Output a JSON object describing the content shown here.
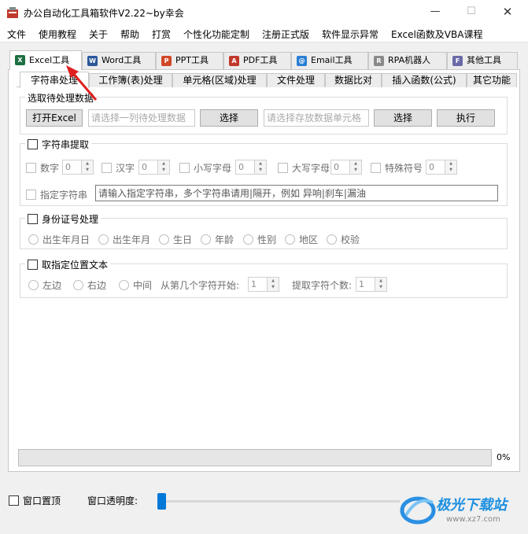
{
  "window": {
    "title": "办公自动化工具箱软件V2.22~by幸会",
    "minimize": "—",
    "maximize": "☐",
    "close": "✕"
  },
  "menu": [
    "文件",
    "使用教程",
    "关于",
    "帮助",
    "打赏",
    "个性化功能定制",
    "注册正式版",
    "软件显示异常",
    "Excel函数及VBA课程"
  ],
  "top_tabs": [
    {
      "label": "Excel工具",
      "icon": "excel-icon",
      "icon_text": "X",
      "color": "#1d6f42"
    },
    {
      "label": "Word工具",
      "icon": "word-icon",
      "icon_text": "W",
      "color": "#2b579a"
    },
    {
      "label": "PPT工具",
      "icon": "ppt-icon",
      "icon_text": "P",
      "color": "#d24726"
    },
    {
      "label": "PDF工具",
      "icon": "pdf-icon",
      "icon_text": "A",
      "color": "#c0392b"
    },
    {
      "label": "Email工具",
      "icon": "email-icon",
      "icon_text": "@",
      "color": "#2a7fd4"
    },
    {
      "label": "RPA机器人",
      "icon": "robot-icon",
      "icon_text": "R",
      "color": "#8a8a8a"
    },
    {
      "label": "其他工具",
      "icon": "folder-icon",
      "icon_text": "F",
      "color": "#6a6aa8"
    }
  ],
  "sub_tabs": [
    "字符串处理",
    "工作簿(表)处理",
    "单元格(区域)处理",
    "文件处理",
    "数据比对",
    "插入函数(公式)",
    "其它功能"
  ],
  "select_group": {
    "title": "选取待处理数据",
    "open_button": "打开Excel",
    "range_placeholder": "请选择一列待处理数据",
    "select_button_1": "选择",
    "store_placeholder": "请选择存放数据单元格",
    "select_button_2": "选择",
    "execute_button": "执行"
  },
  "string_extract": {
    "title": "字符串提取",
    "options": [
      {
        "label": "数字",
        "value": "0"
      },
      {
        "label": "汉字",
        "value": "0"
      },
      {
        "label": "小写字母",
        "value": "0"
      },
      {
        "label": "大写字母",
        "value": "0"
      },
      {
        "label": "特殊符号",
        "value": "0"
      }
    ],
    "specified_label": "指定字符串",
    "specified_value": "请输入指定字符串，多个字符串请用|隔开，例如 异响|刹车|漏油"
  },
  "id_card": {
    "title": "身份证号处理",
    "options": [
      "出生年月日",
      "出生年月",
      "生日",
      "年龄",
      "性别",
      "地区",
      "校验"
    ]
  },
  "position_text": {
    "title": "取指定位置文本",
    "options": [
      "左边",
      "右边",
      "中间"
    ],
    "start_label": "从第几个字符开始:",
    "start_value": "1",
    "count_label": "提取字符个数:",
    "count_value": "1"
  },
  "progress": {
    "percent": 0,
    "text": "0%"
  },
  "bottom": {
    "pin_label": "窗口置顶",
    "opacity_label": "窗口透明度:",
    "opacity_value": 0
  },
  "watermark": {
    "text": "极光下载站",
    "url": "www.xz7.com"
  },
  "colors": {
    "accent": "#0078d7",
    "arrow": "#e02020"
  }
}
